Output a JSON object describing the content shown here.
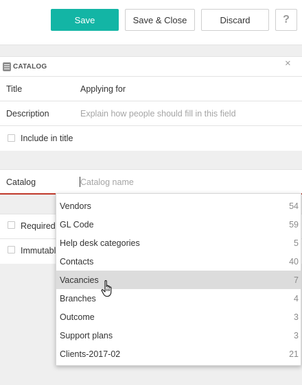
{
  "toolbar": {
    "save_label": "Save",
    "save_close_label": "Save & Close",
    "discard_label": "Discard",
    "help_label": "?"
  },
  "panel": {
    "title": "CATALOG",
    "close_icon": "×",
    "fields": {
      "title_label": "Title",
      "title_value": "Applying for",
      "description_label": "Description",
      "description_placeholder": "Explain how people should fill in this field",
      "include_in_title_label": "Include in title"
    }
  },
  "catalog_field": {
    "label": "Catalog",
    "placeholder": "Catalog name"
  },
  "options": {
    "required_label": "Required",
    "immutable_label": "Immutable"
  },
  "dropdown": {
    "items": [
      {
        "name": "Vendors",
        "count": "54"
      },
      {
        "name": "GL Code",
        "count": "59"
      },
      {
        "name": "Help desk categories",
        "count": "5"
      },
      {
        "name": "Contacts",
        "count": "40"
      },
      {
        "name": "Vacancies",
        "count": "7"
      },
      {
        "name": "Branches",
        "count": "4"
      },
      {
        "name": "Outcome",
        "count": "3"
      },
      {
        "name": "Support plans",
        "count": "3"
      },
      {
        "name": "Clients-2017-02",
        "count": "21"
      }
    ],
    "hovered_index": 4
  },
  "colors": {
    "accent": "#13b5a5",
    "active_underline": "#c0392b",
    "hover_row": "#dcdcdc"
  }
}
